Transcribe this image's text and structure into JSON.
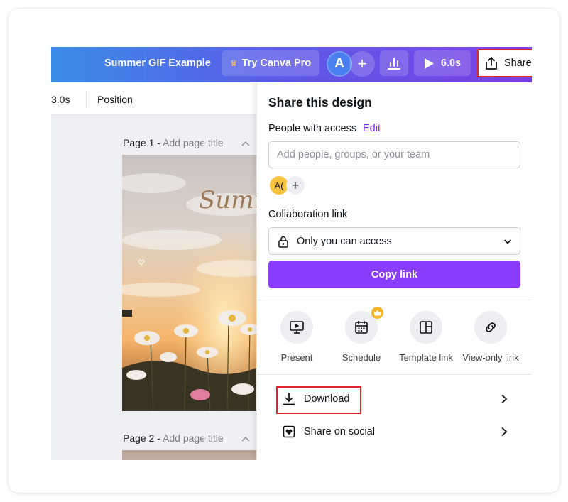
{
  "topbar": {
    "doc_title": "Summer GIF Example",
    "pro_button": "Try Canva Pro",
    "avatar_letter": "A",
    "add_label": "+",
    "play_duration": "6.0s",
    "share_label": "Share"
  },
  "toolbar": {
    "duration": "3.0s",
    "position": "Position"
  },
  "pages": [
    {
      "label": "Page 1 -",
      "title_placeholder": "Add page title",
      "image_text": "Summ"
    },
    {
      "label": "Page 2 -",
      "title_placeholder": "Add page title"
    }
  ],
  "share_panel": {
    "title": "Share this design",
    "people_access_label": "People with access",
    "edit_label": "Edit",
    "input_placeholder": "Add people, groups, or your team",
    "member_avatar": "A(",
    "member_add": "+",
    "collab_label": "Collaboration link",
    "access_value": "Only you can access",
    "copy_button": "Copy link",
    "options": [
      {
        "label": "Present",
        "icon": "present-icon"
      },
      {
        "label": "Schedule",
        "icon": "calendar-icon",
        "pro": true
      },
      {
        "label": "Template link",
        "icon": "template-icon"
      },
      {
        "label": "View-only link",
        "icon": "link-icon"
      }
    ],
    "rows": [
      {
        "label": "Download",
        "icon": "download-icon",
        "highlighted": true
      },
      {
        "label": "Share on social",
        "icon": "heart-icon"
      }
    ]
  },
  "colors": {
    "accent_purple": "#8b3dff",
    "edit_purple": "#7d2ae8",
    "highlight_red": "#e0242b",
    "pro_gold": "#f5b429"
  }
}
